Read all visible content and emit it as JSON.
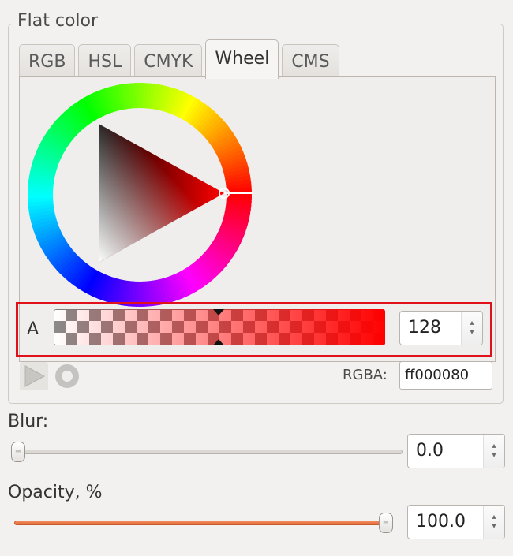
{
  "group": {
    "title": "Flat color"
  },
  "tabs": [
    {
      "label": "RGB",
      "active": false
    },
    {
      "label": "HSL",
      "active": false
    },
    {
      "label": "CMYK",
      "active": false
    },
    {
      "label": "Wheel",
      "active": true
    },
    {
      "label": "CMS",
      "active": false
    }
  ],
  "wheel": {
    "hue_color": "#ff0000"
  },
  "alpha": {
    "label": "A",
    "value": "128",
    "max": 255,
    "color": "#ff0000",
    "arrow_up": "▴",
    "arrow_down": "▾"
  },
  "icons": {
    "triangle": "triangle-icon",
    "ring": "ring-icon"
  },
  "rgba": {
    "label": "RGBA:",
    "value": "ff000080"
  },
  "blur": {
    "label": "Blur:",
    "value": "0.0",
    "fraction": 0.0
  },
  "opacity": {
    "label": "Opacity, %",
    "value": "100.0",
    "fraction": 1.0
  },
  "colors": {
    "accent_highlight": "#e0111b",
    "slider_fill": "#e9743f"
  }
}
